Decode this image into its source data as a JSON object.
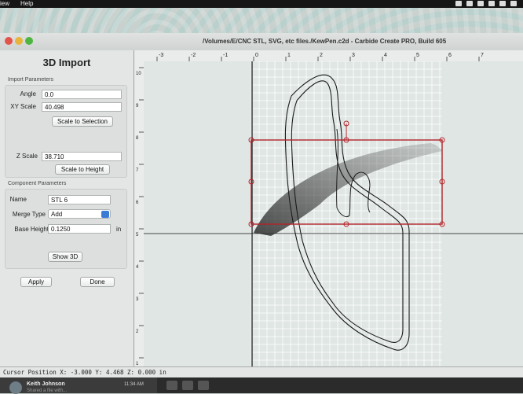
{
  "menubar": {
    "items": [
      "iew",
      "Help"
    ]
  },
  "window": {
    "title": "/Volumes/E/CNC STL, SVG, etc files./KewPen.c2d - Carbide Create PRO, Build 605"
  },
  "panel": {
    "title": "3D Import",
    "import_params_label": "Import Parameters",
    "angle_label": "Angle",
    "angle_value": "0.0",
    "xy_scale_label": "XY Scale",
    "xy_scale_value": "40.498",
    "scale_to_selection_label": "Scale to Selection",
    "z_scale_label": "Z Scale",
    "z_scale_value": "38.710",
    "scale_to_height_label": "Scale to Height",
    "component_params_label": "Component Parameters",
    "name_label": "Name",
    "name_value": "STL 6",
    "merge_type_label": "Merge Type",
    "merge_type_value": "Add",
    "base_height_label": "Base Height",
    "base_height_value": "0.1250",
    "base_height_unit": "in",
    "show3d_label": "Show 3D",
    "apply_label": "Apply",
    "done_label": "Done"
  },
  "ruler": {
    "x_ticks": [
      "-3",
      "-2",
      "-1",
      "0",
      "1",
      "2",
      "3",
      "4",
      "5",
      "6",
      "7"
    ],
    "y_ticks": [
      "10",
      "9",
      "8",
      "7",
      "6",
      "5",
      "4",
      "3",
      "2",
      "1"
    ]
  },
  "status": {
    "cursor_position": "Cursor Position X: -3.000 Y: 4.468 Z: 0.000 in"
  },
  "notification": {
    "name": "Keith Johnson",
    "time": "11:34 AM",
    "preview": "Shared a file with..."
  },
  "colors": {
    "selection": "#b3242a",
    "grid_line": "#ffffff",
    "axis": "#111111",
    "toolpath_outline": "#1a1a1a"
  },
  "icons": [
    "screen-icon",
    "calendar-icon",
    "user-icon",
    "wifi-icon",
    "volume-icon",
    "battery-icon"
  ]
}
